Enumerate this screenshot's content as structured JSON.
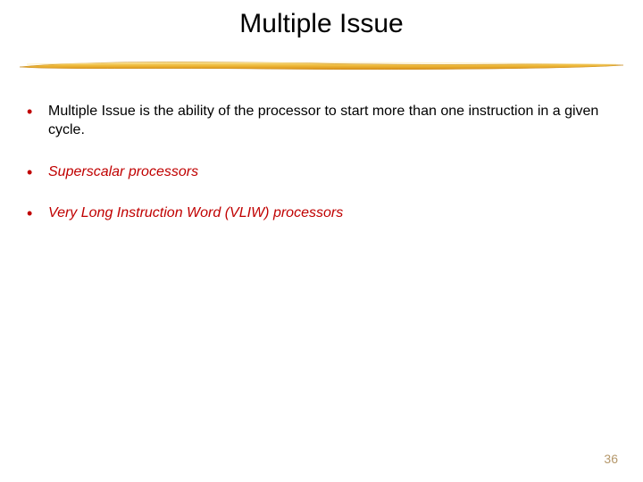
{
  "title": "Multiple Issue",
  "bullets": [
    {
      "text": "Multiple Issue is the ability of the processor to start more than one instruction in a given cycle.",
      "style": "plain"
    },
    {
      "text": "Superscalar processors",
      "style": "red-italic"
    },
    {
      "text": "Very Long Instruction Word (VLIW) processors",
      "style": "red-italic"
    }
  ],
  "page_number": "36",
  "bullet_char": "•"
}
